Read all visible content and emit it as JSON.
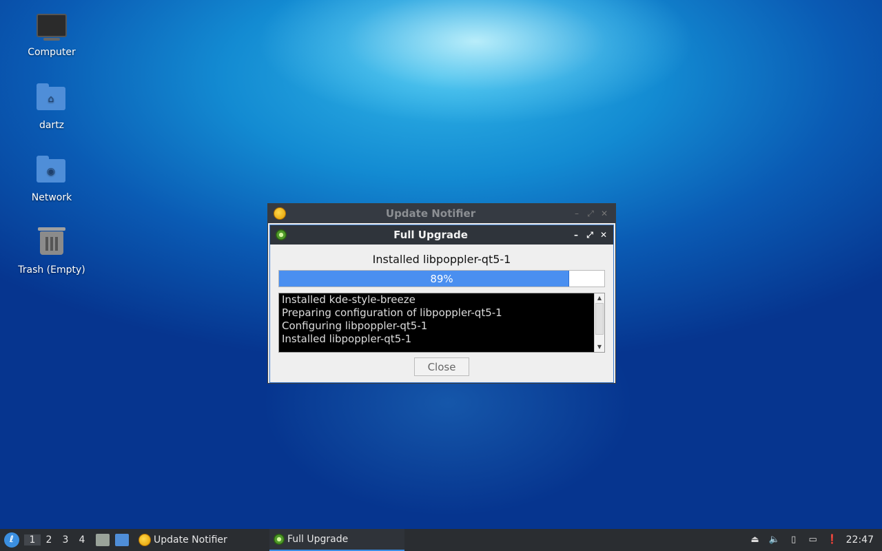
{
  "desktop": {
    "icons": [
      {
        "label": "Computer",
        "icon": "computer-icon"
      },
      {
        "label": "dartz",
        "icon": "home-folder-icon"
      },
      {
        "label": "Network",
        "icon": "network-folder-icon"
      },
      {
        "label": "Trash (Empty)",
        "icon": "trash-icon"
      }
    ]
  },
  "parent_window": {
    "title": "Update Notifier",
    "controls": [
      "–",
      "⤢",
      "✕"
    ]
  },
  "dialog": {
    "title": "Full Upgrade",
    "controls": [
      "–",
      "⤢",
      "✕"
    ],
    "status": "Installed libpoppler-qt5-1",
    "progress": {
      "percent": 89,
      "label": "89%"
    },
    "log_lines": [
      "Installed kde-style-breeze",
      "Preparing configuration of libpoppler-qt5-1",
      "Configuring libpoppler-qt5-1",
      "Installed libpoppler-qt5-1"
    ],
    "close_label": "Close"
  },
  "taskbar": {
    "workspaces": [
      "1",
      "2",
      "3",
      "4"
    ],
    "active_workspace": "1",
    "tasks": [
      {
        "label": "Update Notifier",
        "icon": "update-notifier-icon",
        "active": false
      },
      {
        "label": "Full Upgrade",
        "icon": "gear-icon",
        "active": true
      }
    ],
    "clock": "22:47"
  },
  "colors": {
    "accent": "#4a8ff0",
    "titlebar": "#2f343b"
  }
}
